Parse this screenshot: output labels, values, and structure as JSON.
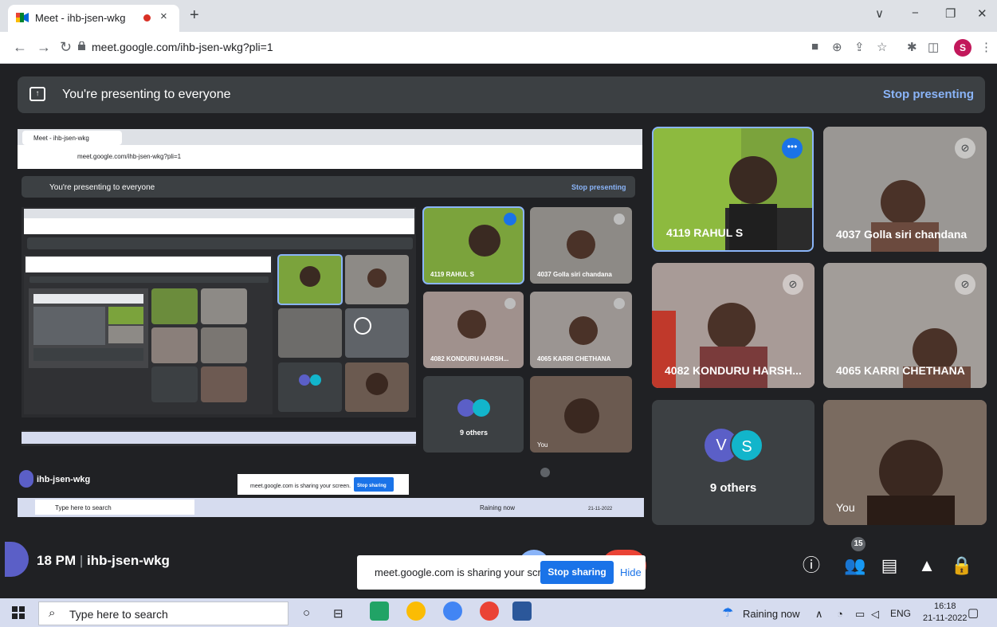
{
  "browser": {
    "tab_title": "Meet - ihb-jsen-wkg",
    "tab_close": "×",
    "new_tab": "+",
    "url": "meet.google.com/ihb-jsen-wkg?pli=1",
    "profile_initial": "S",
    "window_controls": [
      "∨",
      "−",
      "❐",
      "✕"
    ]
  },
  "banner": {
    "text": "You're presenting to everyone",
    "stop_label": "Stop presenting"
  },
  "participants": [
    {
      "name": "4119 RAHUL S",
      "muted": false,
      "bg": "#7ba33c"
    },
    {
      "name": "4037 Golla siri chandana",
      "muted": true,
      "bg": "#8d8a86"
    },
    {
      "name": "4082 KONDURU HARSH...",
      "muted": true,
      "bg": "#a0918d"
    },
    {
      "name": "4065 KARRI CHETHANA",
      "muted": true,
      "bg": "#9b9592"
    }
  ],
  "others": {
    "avatars": [
      "V",
      "S"
    ],
    "label": "9 others"
  },
  "self_tile": {
    "name": "You"
  },
  "meeting": {
    "time": "18 PM",
    "separator": "|",
    "code": "ihb-jsen-wkg",
    "participants_count": "15"
  },
  "share_notice": {
    "text": "meet.google.com is sharing your screen.",
    "stop_label": "Stop sharing",
    "hide_label": "Hide"
  },
  "taskbar": {
    "search_placeholder": "Type here to search",
    "weather": "Raining now",
    "lang": "ENG",
    "time": "16:18",
    "date": "21-11-2022"
  },
  "colors": {
    "accent": "#1a73e8",
    "meet_bg": "#202124",
    "tile_bg": "#3c4043",
    "link": "#8ab4f8"
  }
}
